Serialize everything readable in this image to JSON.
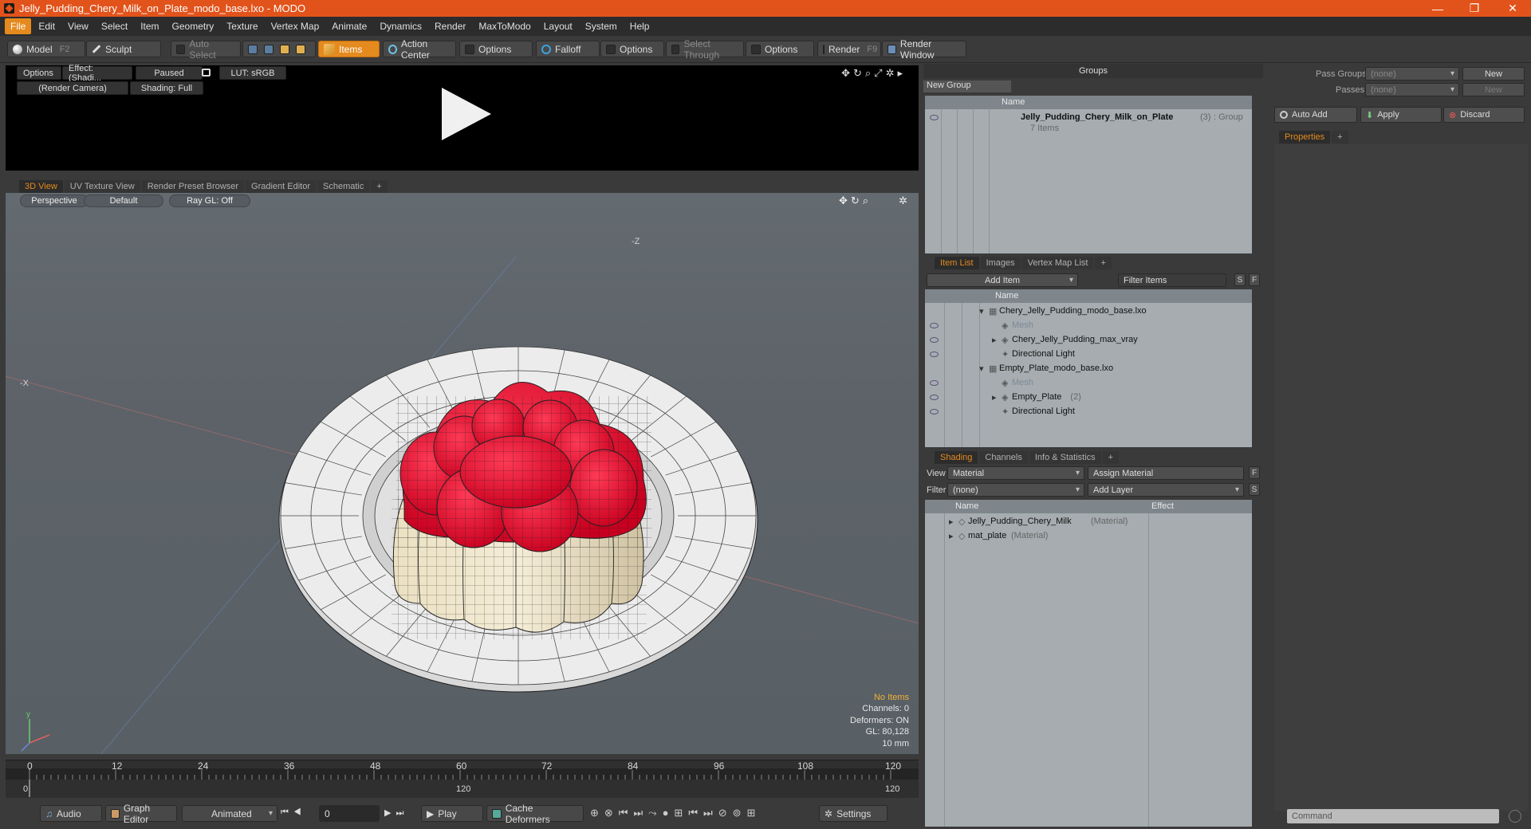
{
  "window": {
    "title": "Jelly_Pudding_Chery_Milk_on_Plate_modo_base.lxo - MODO",
    "minimize": "—",
    "restore": "❐",
    "close": "✕"
  },
  "menu": [
    "File",
    "Edit",
    "View",
    "Select",
    "Item",
    "Geometry",
    "Texture",
    "Vertex Map",
    "Animate",
    "Dynamics",
    "Render",
    "MaxToModo",
    "Layout",
    "System",
    "Help"
  ],
  "toolbar": {
    "model": "Model",
    "model_key": "F2",
    "sculpt": "Sculpt",
    "auto_select": "Auto Select",
    "items": "Items",
    "action_center": "Action Center",
    "options1": "Options",
    "falloff": "Falloff",
    "options2": "Options",
    "select_through": "Select Through",
    "options3": "Options",
    "render": "Render",
    "render_key": "F9",
    "render_window": "Render Window"
  },
  "preview": {
    "options": "Options",
    "effect": "Effect: (Shadi...",
    "paused": "Paused",
    "lut": "LUT: sRGB",
    "camera": "(Render Camera)",
    "shading": "Shading: Full"
  },
  "viewport_tabs": [
    "3D View",
    "UV Texture View",
    "Render Preset Browser",
    "Gradient Editor",
    "Schematic",
    "+"
  ],
  "viewport": {
    "perspective": "Perspective",
    "default": "Default",
    "raygl": "Ray GL: Off",
    "axis_z": "-Z",
    "axis_x": "-X"
  },
  "vp_info": {
    "items": "No Items",
    "channels": "Channels: 0",
    "deformers": "Deformers: ON",
    "gl": "GL: 80,128",
    "unit": "10 mm"
  },
  "timeline": {
    "ticks_top": [
      "0",
      "12",
      "24",
      "36",
      "48",
      "60",
      "72",
      "84",
      "96",
      "108",
      "120"
    ],
    "ticks_bottom": [
      "0",
      "120",
      "120"
    ]
  },
  "bottom": {
    "audio": "Audio",
    "graph_editor": "Graph Editor",
    "animated": "Animated",
    "frame": "0",
    "play": "Play",
    "cache": "Cache Deformers",
    "settings": "Settings"
  },
  "groups": {
    "title": "Groups",
    "new_group": "New Group",
    "col_name": "Name",
    "item_name": "Jelly_Pudding_Chery_Milk_on_Plate",
    "item_count": "(3)",
    "item_type": ": Group",
    "item_sub": "7 Items"
  },
  "pass": {
    "pass_groups_label": "Pass Groups",
    "passes_label": "Passes",
    "pass_groups_value": "(none)",
    "passes_value": "(none)",
    "new1": "New",
    "new2": "New"
  },
  "actions": {
    "auto_add": "Auto Add",
    "apply": "Apply",
    "discard": "Discard"
  },
  "properties": {
    "tab": "Properties",
    "plus": "+"
  },
  "itemlist": {
    "tabs": [
      "Item List",
      "Images",
      "Vertex Map List",
      "+"
    ],
    "add_item": "Add Item",
    "filter": "Filter Items",
    "s": "S",
    "f": "F",
    "col_name": "Name",
    "rows": [
      {
        "label": "Chery_Jelly_Pudding_modo_base.lxo",
        "indent": 0,
        "sub": ""
      },
      {
        "label": "Mesh",
        "indent": 2,
        "sub": "",
        "dim": true
      },
      {
        "label": "Chery_Jelly_Pudding_max_vray",
        "indent": 2,
        "sub": ""
      },
      {
        "label": "Directional Light",
        "indent": 2,
        "sub": ""
      },
      {
        "label": "Empty_Plate_modo_base.lxo",
        "indent": 0,
        "sub": ""
      },
      {
        "label": "Mesh",
        "indent": 2,
        "sub": "",
        "dim": true
      },
      {
        "label": "Empty_Plate",
        "indent": 2,
        "sub": "(2)"
      },
      {
        "label": "Directional Light",
        "indent": 2,
        "sub": ""
      }
    ]
  },
  "shading": {
    "tabs": [
      "Shading",
      "Channels",
      "Info & Statistics",
      "+"
    ],
    "view_label": "View",
    "view_value": "Material",
    "assign": "Assign Material",
    "filter_label": "Filter",
    "filter_value": "(none)",
    "add_layer": "Add Layer",
    "col_name": "Name",
    "col_effect": "Effect",
    "rows": [
      {
        "label": "Jelly_Pudding_Chery_Milk",
        "sub": "(Material)"
      },
      {
        "label": "mat_plate",
        "sub": "(Material)"
      }
    ]
  },
  "command": {
    "placeholder": "Command"
  }
}
